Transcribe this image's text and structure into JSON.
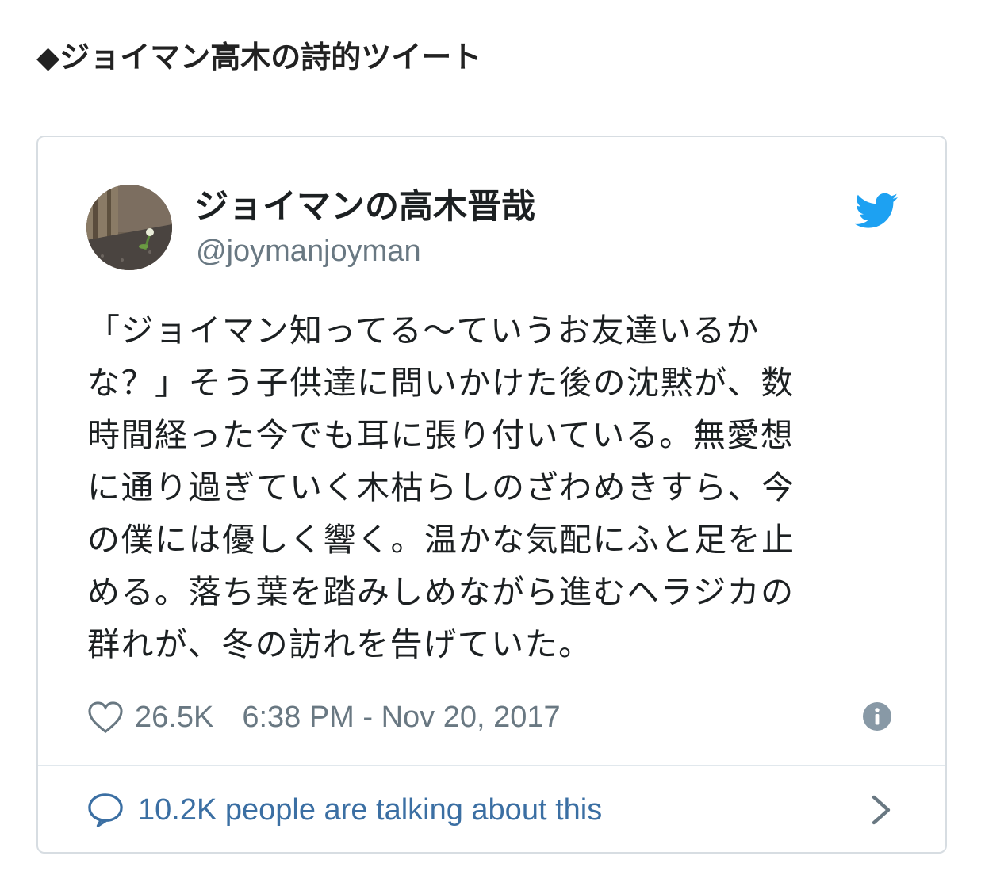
{
  "section": {
    "heading": "◆ジョイマン高木の詩的ツイート"
  },
  "tweet": {
    "display_name": "ジョイマンの高木晋哉",
    "handle": "@joymanjoyman",
    "text": "「ジョイマン知ってる〜ていうお友達いるか\nな？」そう子供達に問いかけた後の沈黙が、数\n時間経った今でも耳に張り付いている。無愛想\nに通り過ぎていく木枯らしのざわめきすら、今\nの僕には優しく響く。温かな気配にふと足を止\nめる。落ち葉を踏みしめながら進むヘラジカの\n群れが、冬の訪れを告げていた。",
    "like_count": "26.5K",
    "timestamp": "6:38 PM - Nov 20, 2017",
    "talking_text": "10.2K people are talking about this",
    "icons": {
      "brand": "twitter-bird-icon",
      "like": "heart-icon",
      "info": "info-icon",
      "reply": "speech-bubble-icon",
      "more": "chevron-right-icon"
    },
    "colors": {
      "brand": "#1da1f2",
      "link": "#3b6fa3",
      "muted": "#697882",
      "text": "#1c2022"
    }
  }
}
